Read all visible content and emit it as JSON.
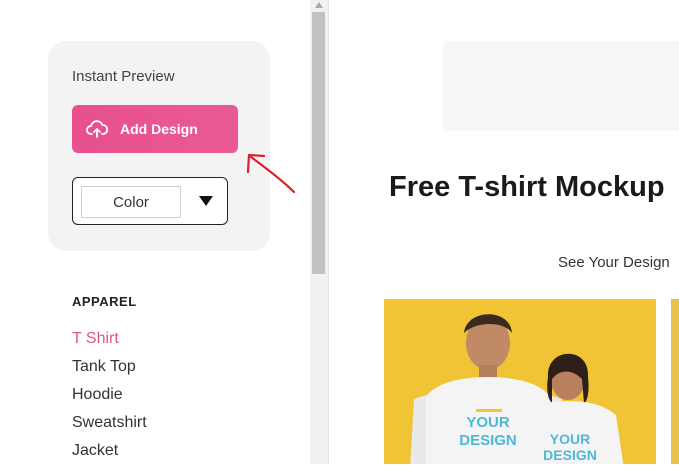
{
  "sidebar": {
    "preview_title": "Instant Preview",
    "add_design_label": "Add Design",
    "color_value": "Color",
    "category_heading": "APPAREL",
    "categories": [
      {
        "label": "T Shirt",
        "active": true
      },
      {
        "label": "Tank Top",
        "active": false
      },
      {
        "label": "Hoodie",
        "active": false
      },
      {
        "label": "Sweatshirt",
        "active": false
      },
      {
        "label": "Jacket",
        "active": false
      }
    ]
  },
  "main": {
    "title": "Free T-shirt Mockup",
    "subtitle": "See Your Design",
    "mockup_shirt_text_1": "YOUR DESIGN",
    "mockup_shirt_text_2": "YOUR DESIGN"
  },
  "colors": {
    "accent": "#e8508f",
    "active_category": "#e2548d",
    "annotation_arrow": "#d9232e",
    "product_bg": "#f0c435"
  },
  "icons": {
    "add_design": "cloud-upload-icon",
    "dropdown": "triangle-down-icon"
  }
}
